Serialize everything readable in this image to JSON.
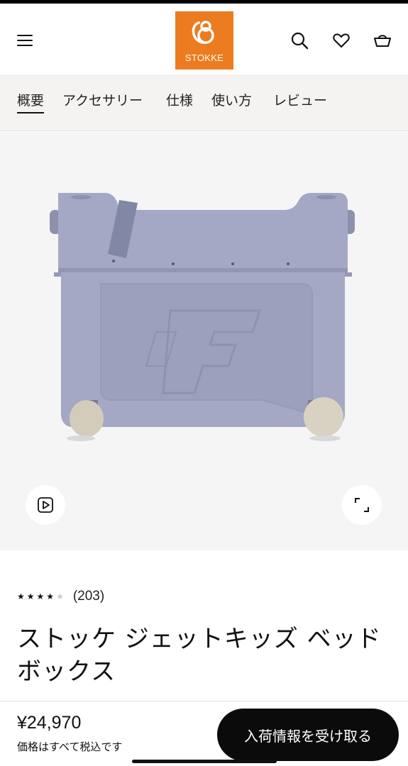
{
  "header": {
    "logo_text": "STOKKE",
    "logo_color": "#ec7c1f",
    "icons": [
      "menu-icon",
      "search-icon",
      "heart-icon",
      "basket-icon"
    ]
  },
  "tabs": [
    {
      "label": "概要",
      "active": true
    },
    {
      "label": "アクセサリー",
      "active": false
    },
    {
      "label": "仕様",
      "active": false
    },
    {
      "label": "使い方",
      "active": false
    },
    {
      "label": "レビュー",
      "active": false
    }
  ],
  "hero": {
    "image": "suitcase-ride-on-bed-box",
    "product_color": "#a4a8c4",
    "buttons": [
      "play-video-icon",
      "expand-icon"
    ]
  },
  "rating": {
    "stars": 4,
    "max": 5,
    "count_text": "(203)"
  },
  "product": {
    "title": "ストッケ ジェットキッズ ベッドボックス"
  },
  "purchase": {
    "price": "¥24,970",
    "tax_note": "価格はすべて税込です",
    "notify_label": "入荷情報を受け取る"
  }
}
